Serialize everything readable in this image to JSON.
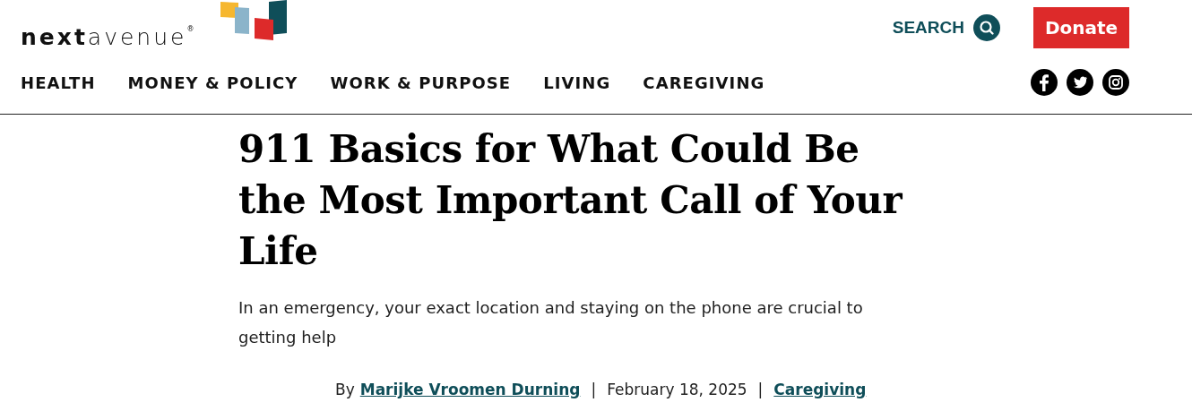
{
  "logo": {
    "bold_part": "next",
    "light_part": "avenue",
    "mark": "®"
  },
  "search": {
    "label": "SEARCH"
  },
  "donate": {
    "label": "Donate"
  },
  "nav": [
    {
      "label": "HEALTH"
    },
    {
      "label": "MONEY & POLICY"
    },
    {
      "label": "WORK & PURPOSE"
    },
    {
      "label": "LIVING"
    },
    {
      "label": "CAREGIVING"
    }
  ],
  "social": [
    {
      "kind": "facebook"
    },
    {
      "kind": "twitter"
    },
    {
      "kind": "instagram"
    }
  ],
  "article": {
    "title": "911 Basics for What Could Be the Most Important Call of Your Life",
    "subtitle": "In an emergency, your exact location and staying on the phone are crucial to getting help",
    "by": "By",
    "author": "Marijke Vroomen Durning",
    "separator_1": "|",
    "date": "February 18, 2025",
    "separator_2": "|",
    "category": "Caregiving"
  }
}
